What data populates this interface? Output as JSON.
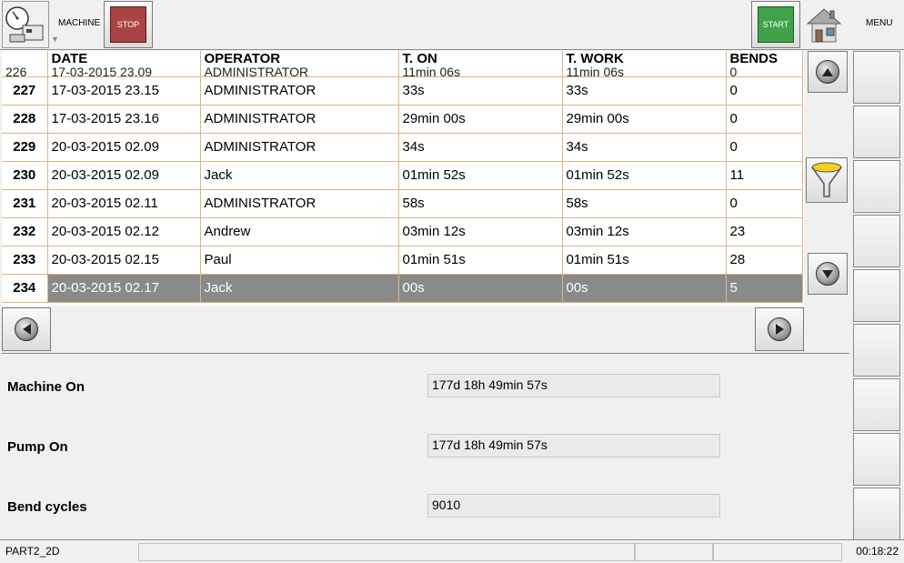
{
  "topbar": {
    "machine_label": "MACHINE",
    "stop_label": "STOP",
    "start_label": "START",
    "menu_label": "MENU",
    "stop_color": "#a44444",
    "start_color": "#3fa24a"
  },
  "table": {
    "columns": [
      "DATE",
      "OPERATOR",
      "T. ON",
      "T. WORK",
      "BENDS"
    ],
    "partial_row": {
      "num": "226",
      "date": "17-03-2015 23.09",
      "operator": "ADMINISTRATOR",
      "t_on": "11min 06s",
      "t_work": "11min 06s",
      "bends": "0"
    },
    "rows": [
      {
        "num": "227",
        "date": "17-03-2015 23.15",
        "operator": "ADMINISTRATOR",
        "t_on": "33s",
        "t_work": "33s",
        "bends": "0"
      },
      {
        "num": "228",
        "date": "17-03-2015 23.16",
        "operator": "ADMINISTRATOR",
        "t_on": "29min 00s",
        "t_work": "29min 00s",
        "bends": "0"
      },
      {
        "num": "229",
        "date": "20-03-2015 02.09",
        "operator": "ADMINISTRATOR",
        "t_on": "34s",
        "t_work": "34s",
        "bends": "0"
      },
      {
        "num": "230",
        "date": "20-03-2015 02.09",
        "operator": "Jack",
        "t_on": "01min 52s",
        "t_work": "01min 52s",
        "bends": "11"
      },
      {
        "num": "231",
        "date": "20-03-2015 02.11",
        "operator": "ADMINISTRATOR",
        "t_on": "58s",
        "t_work": "58s",
        "bends": "0"
      },
      {
        "num": "232",
        "date": "20-03-2015 02.12",
        "operator": "Andrew",
        "t_on": "03min 12s",
        "t_work": "03min 12s",
        "bends": "23"
      },
      {
        "num": "233",
        "date": "20-03-2015 02.15",
        "operator": "Paul",
        "t_on": "01min 51s",
        "t_work": "01min 51s",
        "bends": "28"
      },
      {
        "num": "234",
        "date": "20-03-2015 02.17",
        "operator": "Jack",
        "t_on": "00s",
        "t_work": "00s",
        "bends": "5"
      }
    ],
    "selected_num": "234"
  },
  "info": {
    "machine_on_label": "Machine On",
    "machine_on_value": "177d 18h 49min 57s",
    "pump_on_label": "Pump On",
    "pump_on_value": "177d 18h 49min 57s",
    "bend_cycles_label": "Bend cycles",
    "bend_cycles_value": "9010"
  },
  "statusbar": {
    "program": "PART2_2D",
    "time": "00:18:22"
  }
}
